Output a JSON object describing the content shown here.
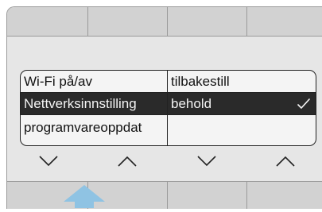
{
  "menu": {
    "left_items": [
      {
        "label": "Wi-Fi på/av"
      },
      {
        "label": "Nettverksinnstilling"
      },
      {
        "label": "programvareoppdat"
      }
    ],
    "right_items": [
      {
        "label": "tilbakestill"
      },
      {
        "label": "behold"
      },
      {
        "label": ""
      }
    ],
    "selected_row": 1
  },
  "nav_arrows": [
    "chevron-down-icon",
    "chevron-up-icon",
    "chevron-down-icon",
    "chevron-up-icon"
  ],
  "colors": {
    "pointer": "#8fc3e3",
    "selection": "#2a2a2a",
    "softkey": "#d2d2d2",
    "screen": "#e6e6e6"
  }
}
